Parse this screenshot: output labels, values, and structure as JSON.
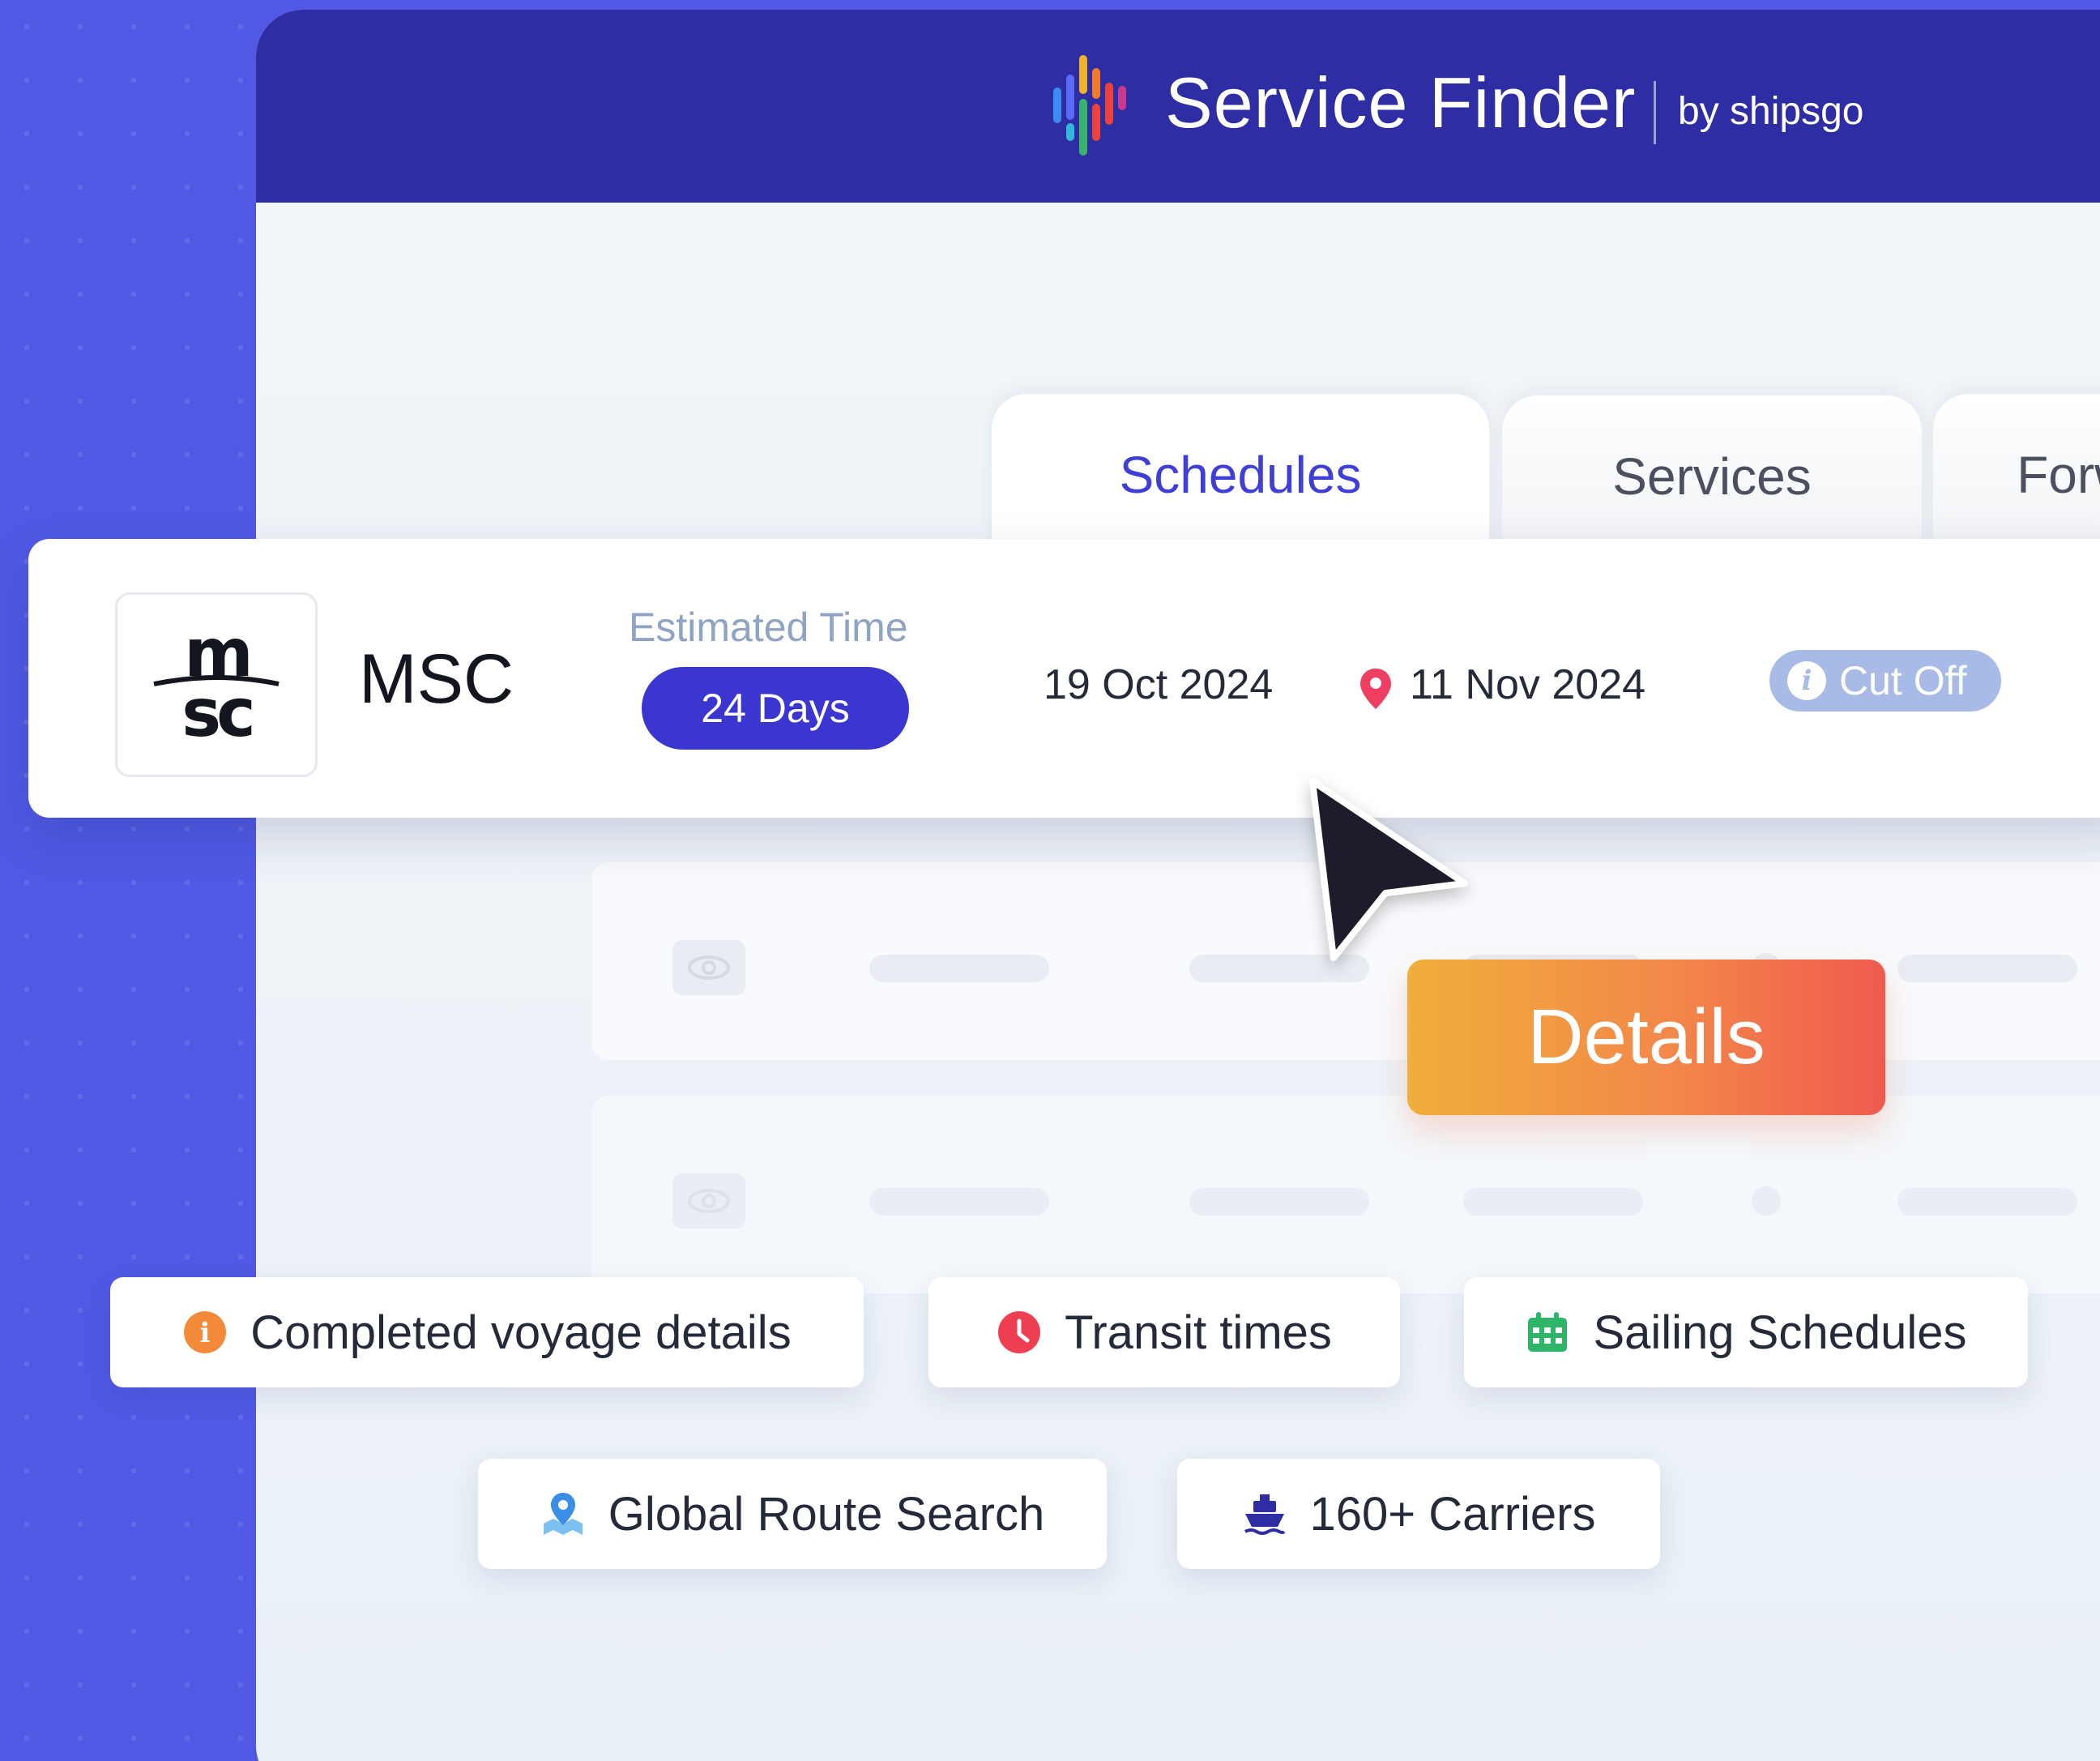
{
  "header": {
    "title": "Service Finder",
    "byline": "by shipsgo"
  },
  "tabs": [
    {
      "label": "Schedules",
      "active": true
    },
    {
      "label": "Services",
      "active": false
    },
    {
      "label": "Forwarders",
      "active": false
    }
  ],
  "schedule": {
    "carrier_logo_text": "msc",
    "carrier_name": "MSC",
    "estimated_label": "Estimated Time",
    "estimated_value": "24 Days",
    "departure_date": "19 Oct 2024",
    "arrival_date": "11 Nov 2024",
    "cutoff_label": "Cut Off"
  },
  "details_button": "Details",
  "features": [
    {
      "label": "Completed voyage details",
      "icon": "info-icon"
    },
    {
      "label": "Transit times",
      "icon": "clock-icon"
    },
    {
      "label": "Sailing Schedules",
      "icon": "calendar-icon"
    },
    {
      "label": "Global Route Search",
      "icon": "map-pin-icon"
    },
    {
      "label": "160+ Carriers",
      "icon": "ship-icon"
    }
  ],
  "colors": {
    "background": "#5159e4",
    "header": "#2e2da3",
    "accent": "#3b36cf",
    "cutoff_badge": "#a8bbe6",
    "details_gradient_start": "#f0ae3a",
    "details_gradient_end": "#f05a4e"
  }
}
